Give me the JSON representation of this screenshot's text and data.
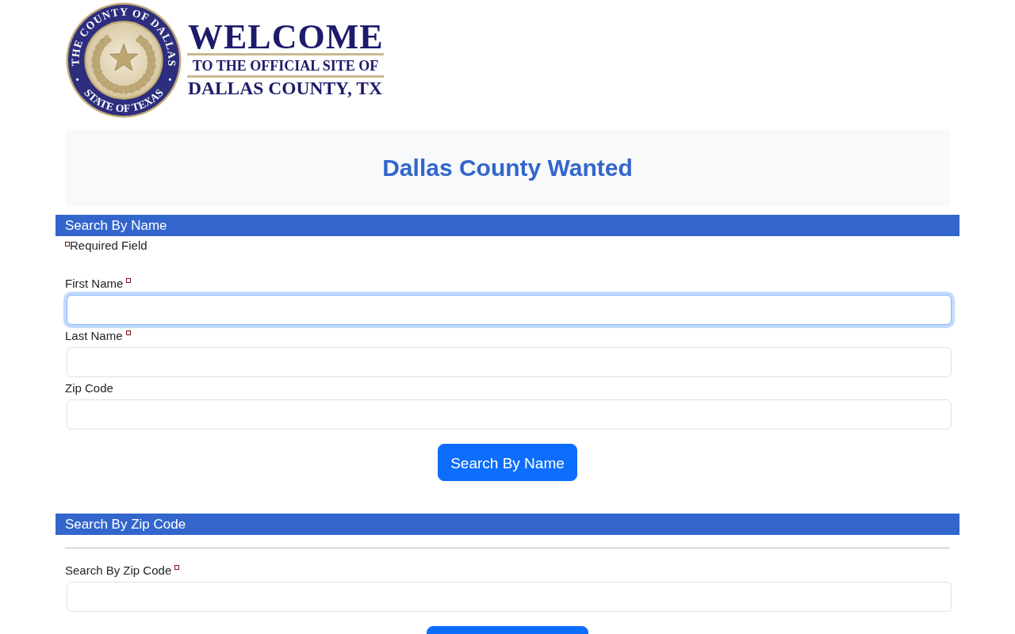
{
  "header": {
    "logo": {
      "seal_top_text": "THE COUNTY OF DALLAS",
      "seal_bottom_text": "STATE OF TEXAS",
      "welcome": "WELCOME",
      "line_1": "TO THE OFFICIAL SITE OF",
      "line_2": "DALLAS COUNTY, TX"
    }
  },
  "page_title": "Dallas County Wanted",
  "sections": [
    {
      "heading": "Search By Name",
      "required_note": "Required Field",
      "divider": false,
      "fields": [
        {
          "label": "First Name",
          "required": true,
          "focused": true
        },
        {
          "label": "Last Name",
          "required": true,
          "focused": false
        },
        {
          "label": "Zip Code",
          "required": false,
          "focused": false
        }
      ],
      "button": {
        "kind": "primary",
        "label": "Search By Name"
      }
    },
    {
      "heading": "Search By Zip Code",
      "divider": true,
      "fields": [
        {
          "label": "Search By Zip Code",
          "required": true,
          "focused": false
        }
      ],
      "button": {
        "kind": "primary"
      }
    }
  ]
}
